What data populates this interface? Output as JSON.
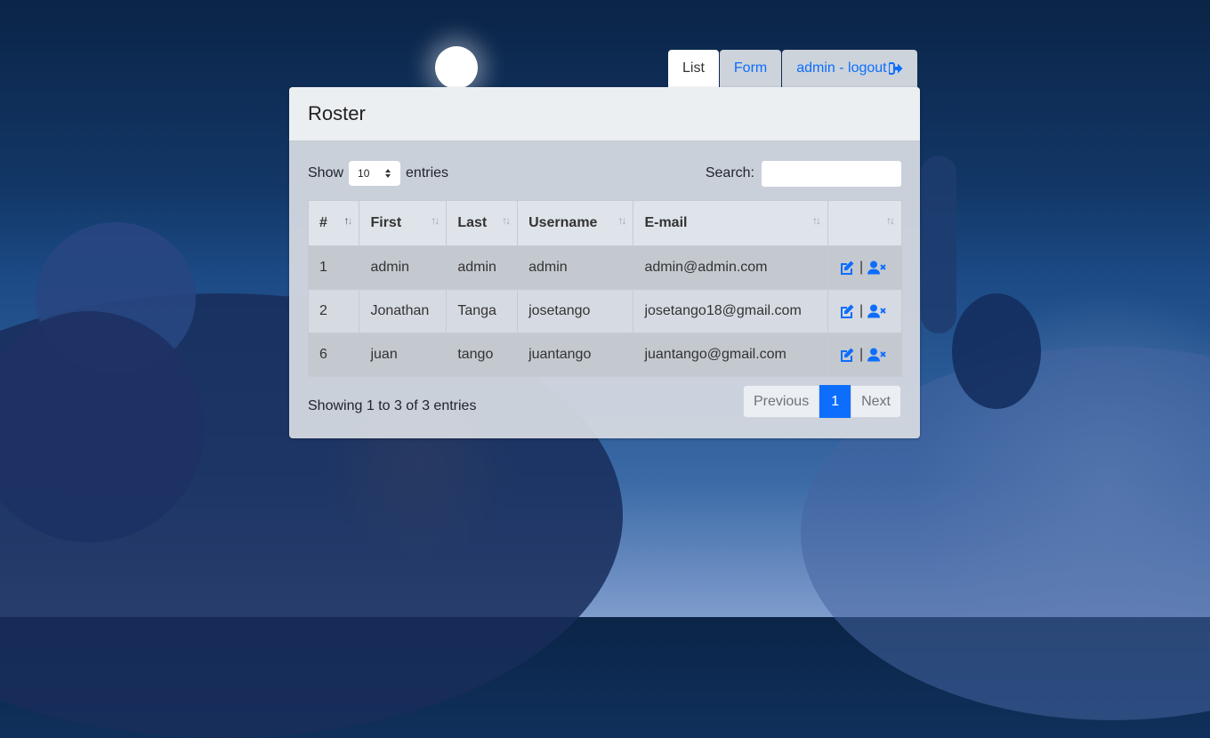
{
  "nav": {
    "tabs": [
      {
        "label": "List",
        "active": true
      },
      {
        "label": "Form",
        "active": false
      },
      {
        "label": "admin - logout",
        "icon": "logout-icon",
        "active": false
      }
    ]
  },
  "card": {
    "title": "Roster",
    "length_prefix": "Show",
    "length_value": "10",
    "length_suffix": "entries",
    "search_label": "Search:",
    "search_value": ""
  },
  "table": {
    "columns": [
      "#",
      "First",
      "Last",
      "Username",
      "E-mail",
      ""
    ],
    "rows": [
      {
        "id": "1",
        "first": "admin",
        "last": "admin",
        "username": "admin",
        "email": "admin@admin.com"
      },
      {
        "id": "2",
        "first": "Jonathan",
        "last": "Tanga",
        "username": "josetango",
        "email": "josetango18@gmail.com"
      },
      {
        "id": "6",
        "first": "juan",
        "last": "tango",
        "username": "juantango",
        "email": "juantango@gmail.com"
      }
    ],
    "action_separator": "|",
    "action_icons": [
      "edit-icon",
      "remove-user-icon"
    ]
  },
  "footer": {
    "info": "Showing 1 to 3 of 3 entries",
    "previous": "Previous",
    "current_page": "1",
    "next": "Next"
  },
  "colors": {
    "accent": "#0d6efd"
  }
}
